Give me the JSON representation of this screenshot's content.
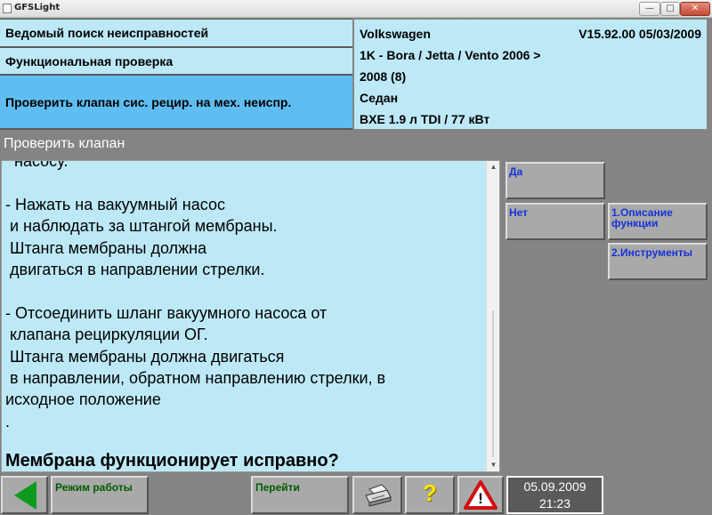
{
  "window": {
    "title": "GFSLight",
    "min_glyph": "—",
    "max_glyph": "□",
    "close_glyph": "✕"
  },
  "header": {
    "row1": "Ведомый поиск неисправностей",
    "row2": "Функциональная проверка",
    "row3": "Проверить клапан сис. рецир. на мех. неиспр.",
    "brand": "Volkswagen",
    "version": "V15.92.00 05/03/2009",
    "model": "1K - Bora / Jetta / Vento 2006 >",
    "model_year": "2008 (8)",
    "body": "Седан",
    "engine": "BXE 1.9 л TDI / 77 кВт"
  },
  "section": {
    "title": "Проверить клапан"
  },
  "content": {
    "body_text": "  насосу.\n\n- Нажать на вакуумный насос\n и наблюдать за штангой мембраны.\n Штанга мембраны должна\n двигаться в направлении стрелки.\n\n- Отсоединить шланг вакуумного насоса от\n клапана рециркуляции ОГ.\n Штанга мембраны должна двигаться\n в направлении, обратном направлению стрелки, в\nисходное положение\n.",
    "question": "Мембрана функционирует исправно?"
  },
  "side_buttons": {
    "yes": "Да",
    "no": "Нет",
    "func_desc": "1.Описание функции",
    "tools": "2.Инструменты"
  },
  "bottom": {
    "mode": "Режим работы",
    "goto": "Перейти",
    "help_glyph": "?",
    "warning_glyph": "!",
    "date": "05.09.2009",
    "time": "21:23"
  },
  "colors": {
    "panel_cyan": "#bde9f7",
    "selected_blue": "#5fbdf1",
    "button_gray": "#a9a9a9",
    "label_blue": "#1632d8",
    "label_green": "#005c00",
    "back_arrow_green": "#0f9a1e",
    "help_yellow": "#f4e400",
    "warning_red": "#d01010"
  },
  "icons": {
    "back": "back-arrow-icon",
    "print": "printer-icon",
    "help": "question-mark-icon",
    "warning": "warning-triangle-icon"
  }
}
